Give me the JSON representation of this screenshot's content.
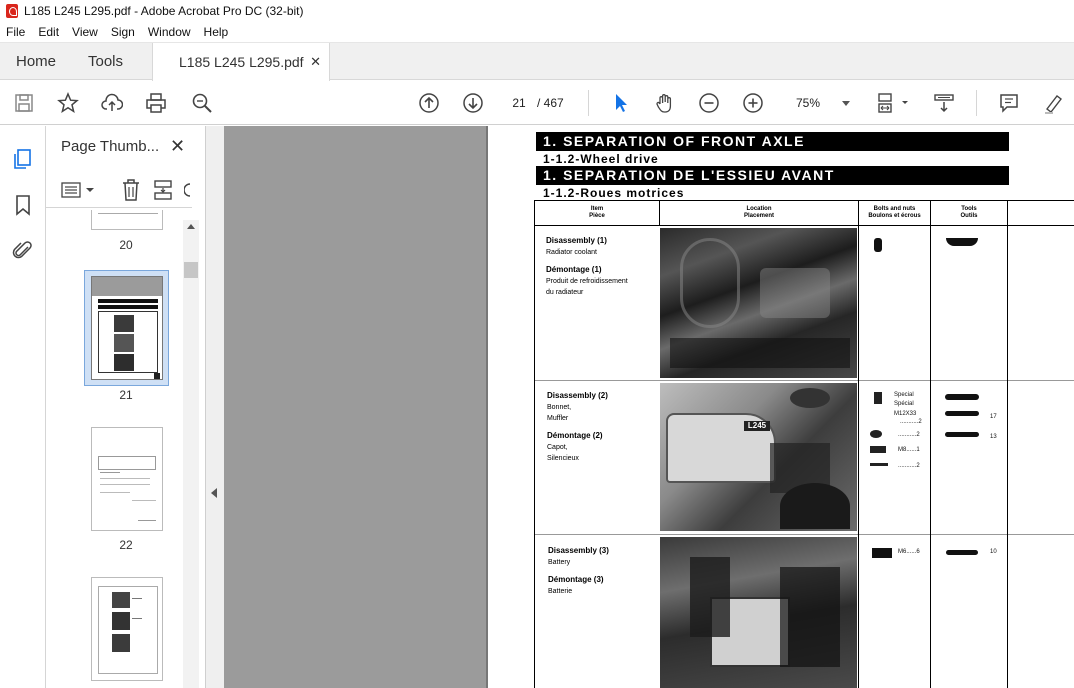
{
  "window": {
    "title": "L185 L245 L295.pdf - Adobe Acrobat Pro DC (32-bit)"
  },
  "menu": [
    "File",
    "Edit",
    "View",
    "Sign",
    "Window",
    "Help"
  ],
  "tabs": {
    "home": "Home",
    "tools": "Tools",
    "document": "L185 L245 L295.pdf"
  },
  "nav": {
    "current_page": "21",
    "total": "/ 467",
    "zoom": "75%"
  },
  "panel": {
    "title": "Page Thumb...",
    "thumb_labels": [
      "20",
      "21",
      "22"
    ]
  },
  "doc": {
    "heading_en": "1. SEPARATION OF FRONT AXLE",
    "sub_en": "1-1.2-Wheel drive",
    "heading_fr": "1. SEPARATION DE L'ESSIEU AVANT",
    "sub_fr": "1-1.2-Roues motrices",
    "col_item": "Item",
    "col_item_fr": "Pièce",
    "col_location": "Location",
    "col_location_fr": "Placement",
    "col_bolts": "Bolts and nuts",
    "col_bolts_fr": "Boulons et écrous",
    "col_tools": "Tools",
    "col_tools_fr": "Outils",
    "rows": [
      {
        "en_head": "Disassembly  (1)",
        "en_text": "Radiator coolant",
        "fr_head": "Démontage  (1)",
        "fr_text1": "Produit de refroidissement",
        "fr_text2": "du radiateur"
      },
      {
        "en_head": "Disassembly  (2)",
        "en_text1": "Bonnet,",
        "en_text2": "Muffler",
        "fr_head": "Démontage  (2)",
        "fr_text1": "Capot,",
        "fr_text2": "Silencieux",
        "bolt_special": "Special",
        "bolt_special_fr": "Spécial",
        "bolt_size": "M12X33",
        "bolt_q1": "...........2",
        "bolt_q2": "...........2",
        "bolt_q3": "M8......1",
        "bolt_q4": "...........2",
        "tool_17": "17",
        "tool_13": "13",
        "photo_label": "L245"
      },
      {
        "en_head": "Disassembly  (3)",
        "en_text": "Battery",
        "fr_head": "Démontage  (3)",
        "fr_text": "Batterie",
        "bolt": "M6......6",
        "tool_10": "10"
      }
    ]
  }
}
